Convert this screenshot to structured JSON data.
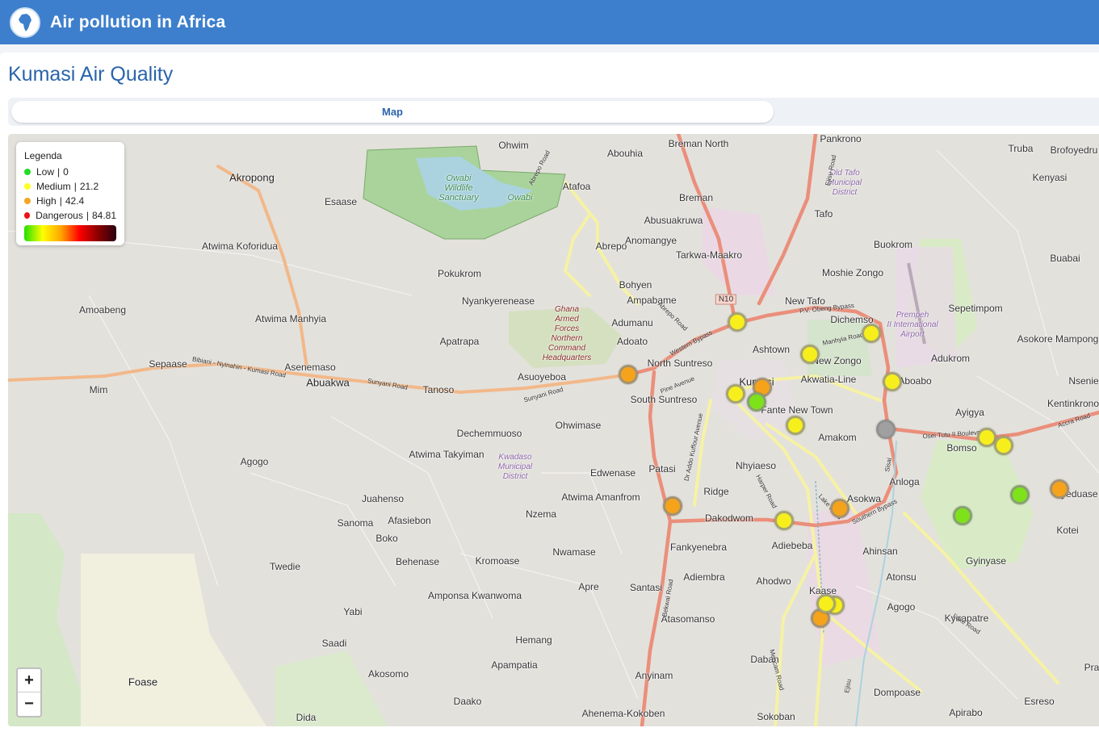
{
  "app": {
    "title": "Air pollution in Africa"
  },
  "page": {
    "title": "Kumasi Air Quality"
  },
  "tabs": [
    {
      "label": "Map"
    }
  ],
  "legend": {
    "title": "Legenda",
    "items": [
      {
        "label": "Low",
        "value": "0",
        "color": "#22dd22"
      },
      {
        "label": "Medium",
        "value": "21.2",
        "color": "#ffff22"
      },
      {
        "label": "High",
        "value": "42.4",
        "color": "#f5a623"
      },
      {
        "label": "Dangerous",
        "value": "84.81",
        "color": "#ee1111"
      }
    ]
  },
  "zoom": {
    "in": "+",
    "out": "−"
  },
  "map": {
    "shields": [
      {
        "text": "N10"
      }
    ],
    "places": [
      {
        "name": "Ohwim"
      },
      {
        "name": "Abouhia"
      },
      {
        "name": "Breman North"
      },
      {
        "name": "Pankrono"
      },
      {
        "name": "Truba"
      },
      {
        "name": "Brofoyedru"
      },
      {
        "name": "Akropong"
      },
      {
        "name": "Esaase"
      },
      {
        "name": "Atafoa"
      },
      {
        "name": "Breman"
      },
      {
        "name": "Tafo"
      },
      {
        "name": "Kenyasi"
      },
      {
        "name": "Abusuakruwa"
      },
      {
        "name": "Abrepo"
      },
      {
        "name": "Anomangye"
      },
      {
        "name": "Tarkwa-Maakro"
      },
      {
        "name": "Buokrom"
      },
      {
        "name": "Buabai"
      },
      {
        "name": "Atwima Koforidua"
      },
      {
        "name": "Pokukrom"
      },
      {
        "name": "Moshie Zongo"
      },
      {
        "name": "Bohyen"
      },
      {
        "name": "Nyankyerenease"
      },
      {
        "name": "Ampabame"
      },
      {
        "name": "New Tafo"
      },
      {
        "name": "Sepetimpom"
      },
      {
        "name": "Amoabeng"
      },
      {
        "name": "Atwima Manhyia"
      },
      {
        "name": "Dichemso"
      },
      {
        "name": "Adumanu"
      },
      {
        "name": "Asokore Mampong"
      },
      {
        "name": "Apatrapa"
      },
      {
        "name": "Adoato"
      },
      {
        "name": "Ashtown"
      },
      {
        "name": "New Zongo"
      },
      {
        "name": "Adukrom"
      },
      {
        "name": "Sepaase"
      },
      {
        "name": "Asenemaso"
      },
      {
        "name": "North Suntreso"
      },
      {
        "name": "Asuoyeboa"
      },
      {
        "name": "Kumasi"
      },
      {
        "name": "Akwatia-Line"
      },
      {
        "name": "Aboabo"
      },
      {
        "name": "Nsenie"
      },
      {
        "name": "Abuakwa"
      },
      {
        "name": "Mim"
      },
      {
        "name": "Tanoso"
      },
      {
        "name": "South Suntreso"
      },
      {
        "name": "Fante New Town"
      },
      {
        "name": "Kentinkrono"
      },
      {
        "name": "Ayigya"
      },
      {
        "name": "Dechemmuoso"
      },
      {
        "name": "Ohwimase"
      },
      {
        "name": "Amakom"
      },
      {
        "name": "Bomso"
      },
      {
        "name": "Atwima Takyiman"
      },
      {
        "name": "Agogo"
      },
      {
        "name": "Edwenase"
      },
      {
        "name": "Patasi"
      },
      {
        "name": "Nhyiaeso"
      },
      {
        "name": "Anloga"
      },
      {
        "name": "Ayeduase"
      },
      {
        "name": "Juahenso"
      },
      {
        "name": "Atwima Amanfrom"
      },
      {
        "name": "Ridge"
      },
      {
        "name": "Asokwa"
      },
      {
        "name": "Sanoma"
      },
      {
        "name": "Afasiebon"
      },
      {
        "name": "Nzema"
      },
      {
        "name": "Dakodwom"
      },
      {
        "name": "Kotei"
      },
      {
        "name": "Boko"
      },
      {
        "name": "Fankyenebra"
      },
      {
        "name": "Adiebeba"
      },
      {
        "name": "Ahinsan"
      },
      {
        "name": "Behenase"
      },
      {
        "name": "Kromoase"
      },
      {
        "name": "Nwamase"
      },
      {
        "name": "Gyinyase"
      },
      {
        "name": "Twedie"
      },
      {
        "name": "Adiembra"
      },
      {
        "name": "Ahodwo"
      },
      {
        "name": "Atonsu"
      },
      {
        "name": "Apre"
      },
      {
        "name": "Santasi"
      },
      {
        "name": "Kaase"
      },
      {
        "name": "Amponsa Kwanwoma"
      },
      {
        "name": "Yabi"
      },
      {
        "name": "Agogo"
      },
      {
        "name": "Kyirapatre"
      },
      {
        "name": "Atasomanso"
      },
      {
        "name": "Saadi"
      },
      {
        "name": "Hemang"
      },
      {
        "name": "Apampatia"
      },
      {
        "name": "Pra"
      },
      {
        "name": "Akosomo"
      },
      {
        "name": "Foase"
      },
      {
        "name": "Anyinam"
      },
      {
        "name": "Daban"
      },
      {
        "name": "Dompoase"
      },
      {
        "name": "Dida"
      },
      {
        "name": "Daako"
      },
      {
        "name": "Esreso"
      },
      {
        "name": "Ahenema-Kokoben"
      },
      {
        "name": "Sokoban"
      },
      {
        "name": "Apirabo"
      }
    ],
    "areas": [
      {
        "name": "Owabi Wildlife Sanctuary"
      },
      {
        "name": "Owabi"
      },
      {
        "name": "Old Tafo Municipal District"
      },
      {
        "name": "Ghana Armed Forces Northern Command Headquarters"
      },
      {
        "name": "Prempeh II International Airport"
      },
      {
        "name": "Kwadaso Municipal District"
      }
    ],
    "roads": [
      {
        "name": "Abrepo Road"
      },
      {
        "name": "Bibiani - Nyinahin - Kumasi Road"
      },
      {
        "name": "Sunyani Road"
      },
      {
        "name": "Sunyani Road"
      },
      {
        "name": "Western Bypass"
      },
      {
        "name": "Abrepo Road"
      },
      {
        "name": "Pine Avenue"
      },
      {
        "name": "Dr Addo Kuffour Avenue"
      },
      {
        "name": "P.V. Obeng Bypass"
      },
      {
        "name": "Manhyia Road"
      },
      {
        "name": "Osei Tutu II Boulevard"
      },
      {
        "name": "Accra Road"
      },
      {
        "name": "Harper Road"
      },
      {
        "name": "Lake Road"
      },
      {
        "name": "Southern Bypass"
      },
      {
        "name": "Bekwai Road"
      },
      {
        "name": "Ejisu Road"
      },
      {
        "name": "Lake Road"
      },
      {
        "name": "Mencam Road"
      },
      {
        "name": "Sisai"
      },
      {
        "name": "Ejisu"
      }
    ],
    "sensors": [
      {
        "level": "high"
      },
      {
        "level": "medium"
      },
      {
        "level": "high"
      },
      {
        "level": "medium"
      },
      {
        "level": "low"
      },
      {
        "level": "medium"
      },
      {
        "level": "medium"
      },
      {
        "level": "medium"
      },
      {
        "level": "medium"
      },
      {
        "level": "offline"
      },
      {
        "level": "medium"
      },
      {
        "level": "medium"
      },
      {
        "level": "high"
      },
      {
        "level": "low"
      },
      {
        "level": "low"
      },
      {
        "level": "high"
      },
      {
        "level": "medium"
      },
      {
        "level": "high"
      },
      {
        "level": "high"
      },
      {
        "level": "medium"
      },
      {
        "level": "medium"
      }
    ],
    "level_colors": {
      "low": "#7ee21a",
      "medium": "#f7ef1c",
      "high": "#f5a31b",
      "offline": "#a0a0a0"
    }
  }
}
